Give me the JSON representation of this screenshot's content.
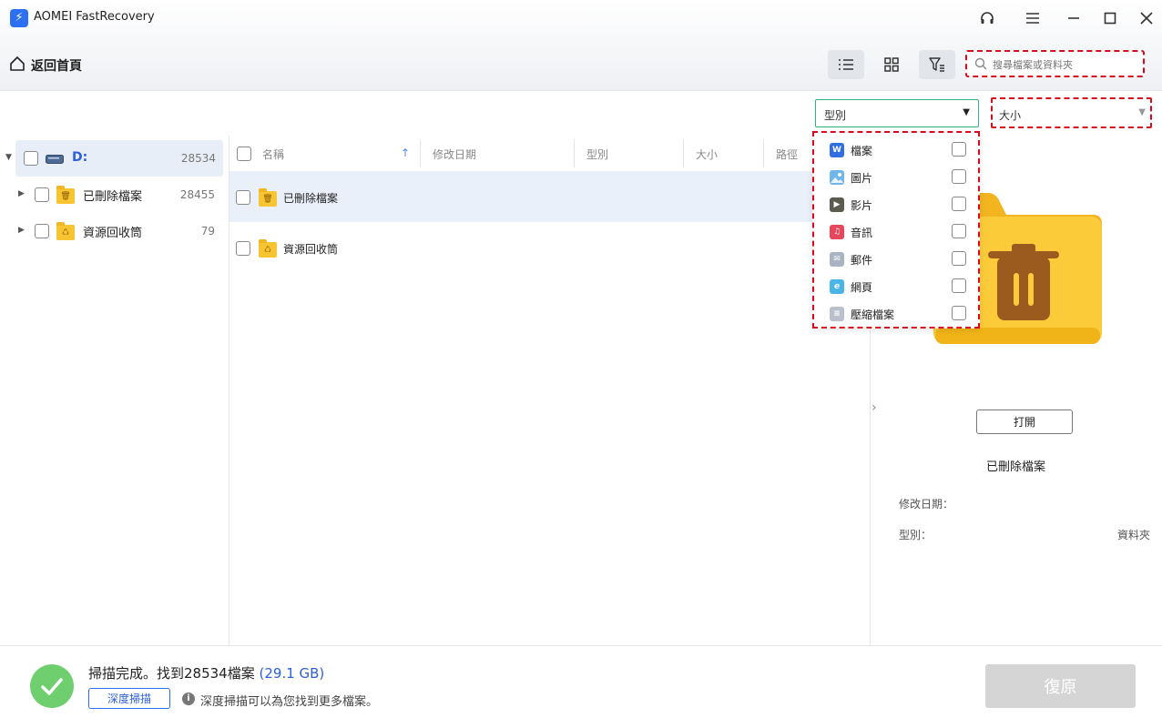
{
  "window": {
    "title": "AOMEI FastRecovery",
    "logo_glyph": "⚡"
  },
  "header": {
    "home_label": "返回首頁"
  },
  "search": {
    "placeholder": "搜尋檔案或資料夾"
  },
  "filters": {
    "type_label": "型別",
    "size_label": "大小",
    "type_options": [
      {
        "label": "檔案",
        "icon": "word-doc-icon",
        "icon_glyph": "W",
        "color": "#2f6fe0"
      },
      {
        "label": "圖片",
        "icon": "image-icon",
        "icon_glyph": "",
        "color": "#6fb6ea"
      },
      {
        "label": "影片",
        "icon": "video-icon",
        "icon_glyph": "▶",
        "color": "#5b5b4e"
      },
      {
        "label": "音訊",
        "icon": "music-icon",
        "icon_glyph": "♫",
        "color": "#e8465a"
      },
      {
        "label": "郵件",
        "icon": "mail-icon",
        "icon_glyph": "✉",
        "color": "#a9b3c4"
      },
      {
        "label": "網頁",
        "icon": "web-page-icon",
        "icon_glyph": "e",
        "color": "#4cb5e8"
      },
      {
        "label": "壓縮檔案",
        "icon": "zip-icon",
        "icon_glyph": "≡",
        "color": "#b9c0cc"
      }
    ]
  },
  "tree": {
    "root": {
      "label": "D:",
      "count": "28534"
    },
    "items": [
      {
        "label": "已刪除檔案",
        "count": "28455",
        "icon": "trash-folder-icon"
      },
      {
        "label": "資源回收筒",
        "count": "79",
        "icon": "recycle-folder-icon"
      }
    ]
  },
  "list": {
    "columns": [
      "名稱",
      "修改日期",
      "型別",
      "大小",
      "路徑"
    ],
    "rows": [
      {
        "name": "已刪除檔案",
        "icon": "trash-folder-icon"
      },
      {
        "name": "資源回收筒",
        "icon": "recycle-folder-icon"
      }
    ]
  },
  "preview": {
    "open_label": "打開",
    "name": "已刪除檔案",
    "modified_label": "修改日期：",
    "modified_value": "",
    "type_label": "型別：",
    "type_value": "資料夾"
  },
  "footer": {
    "status_prefix": "掃描完成。找到28534檔案 ",
    "status_size": "(29.1 GB)",
    "deep_scan_label": "深度掃描",
    "hint": "深度掃描可以為您找到更多檔案。",
    "recover_label": "復原"
  },
  "colors": {
    "accent": "#2c6ff0",
    "highlight_dash": "#d9091b",
    "success": "#6fcf6f"
  }
}
